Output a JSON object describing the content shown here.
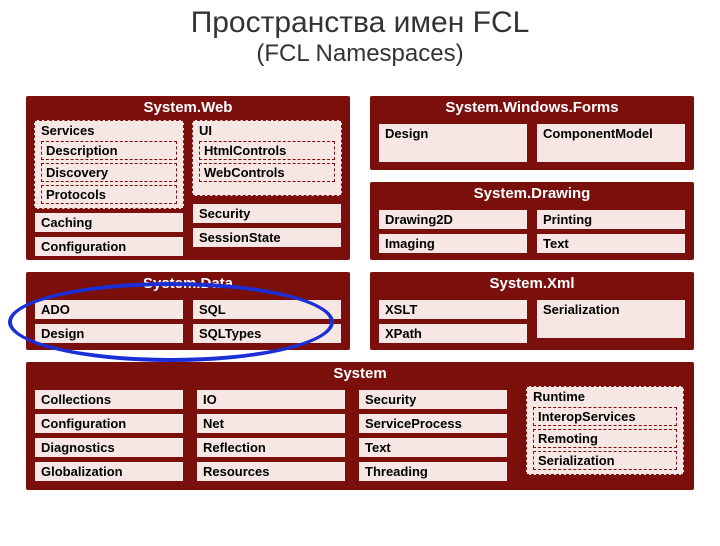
{
  "title": "Пространства имен FCL",
  "subtitle": "(FCL Namespaces)",
  "web": {
    "title": "System.Web",
    "services": {
      "label": "Services",
      "items": [
        "Description",
        "Discovery",
        "Protocols"
      ]
    },
    "ui": {
      "label": "UI",
      "items": [
        "HtmlControls",
        "WebControls"
      ]
    },
    "left": [
      "Caching",
      "Configuration"
    ],
    "right": [
      "Security",
      "SessionState"
    ]
  },
  "winforms": {
    "title": "System.Windows.Forms",
    "items": [
      "Design",
      "ComponentModel"
    ]
  },
  "drawing": {
    "title": "System.Drawing",
    "left": [
      "Drawing2D",
      "Imaging"
    ],
    "right": [
      "Printing",
      "Text"
    ]
  },
  "data": {
    "title": "System.Data",
    "left": [
      "ADO",
      "Design"
    ],
    "right": [
      "SQL",
      "SQLTypes"
    ]
  },
  "xml": {
    "title": "System.Xml",
    "left": [
      "XSLT",
      "XPath"
    ],
    "right": [
      "Serialization"
    ]
  },
  "system": {
    "title": "System",
    "c1": [
      "Collections",
      "Configuration",
      "Diagnostics",
      "Globalization"
    ],
    "c2": [
      "IO",
      "Net",
      "Reflection",
      "Resources"
    ],
    "c3": [
      "Security",
      "ServiceProcess",
      "Text",
      "Threading"
    ],
    "runtime": {
      "label": "Runtime",
      "items": [
        "InteropServices",
        "Remoting",
        "Serialization"
      ]
    }
  }
}
